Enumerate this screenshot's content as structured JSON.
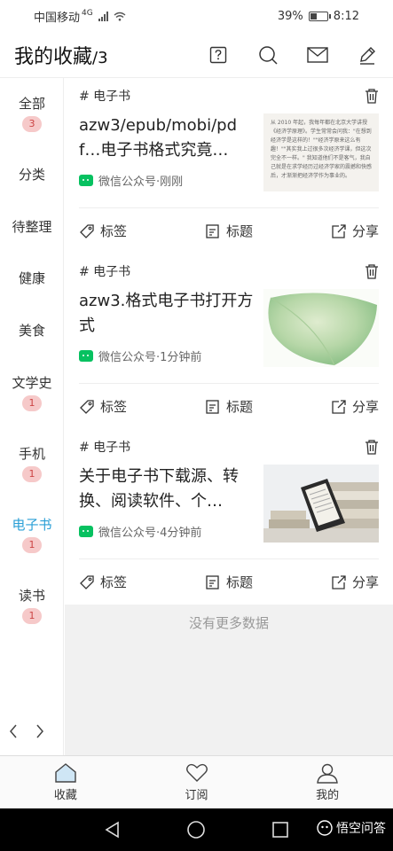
{
  "status": {
    "carrier": "中国移动",
    "network": "4G",
    "battery": "39%",
    "time": "8:12"
  },
  "header": {
    "title": "我的收藏",
    "count": "/3"
  },
  "sidebar": {
    "items": [
      {
        "label": "全部",
        "badge": "3"
      },
      {
        "label": "分类",
        "badge": ""
      },
      {
        "label": "待整理",
        "badge": ""
      },
      {
        "label": "健康",
        "badge": ""
      },
      {
        "label": "美食",
        "badge": ""
      },
      {
        "label": "文学史",
        "badge": "1"
      },
      {
        "label": "手机",
        "badge": "1"
      },
      {
        "label": "电子书",
        "badge": "1"
      },
      {
        "label": "读书",
        "badge": "1"
      }
    ]
  },
  "cards": [
    {
      "tag": "# 电子书",
      "title": "azw3/epub/mobi/pdf…电子书格式究竟…",
      "source": "微信公众号·刚刚",
      "actions": [
        "标签",
        "标题",
        "分享"
      ]
    },
    {
      "tag": "# 电子书",
      "title": "azw3.格式电子书打开方式",
      "source": "微信公众号·1分钟前",
      "actions": [
        "标签",
        "标题",
        "分享"
      ]
    },
    {
      "tag": "# 电子书",
      "title": "关于电子书下载源、转换、阅读软件、个…",
      "source": "微信公众号·4分钟前",
      "actions": [
        "标签",
        "标题",
        "分享"
      ]
    }
  ],
  "thumb_text": "从 2010 年起，我每年都在北京大学讲授《经济学原理》。学生常常会问我：\"在想到经济学是这样的！\"\"经济学原来这么有趣！\"\"其实我上过很多次经济学课，但这次完全不一样。\" 我知道他们不是客气，我自己就是在求学经历过经济学家的震撼和快感后，才渐渐把经济学作为事业的。",
  "no_more": "没有更多数据",
  "bottom_nav": {
    "favorites": "收藏",
    "subscribe": "订阅",
    "mine": "我的"
  },
  "watermark": "悟空问答"
}
